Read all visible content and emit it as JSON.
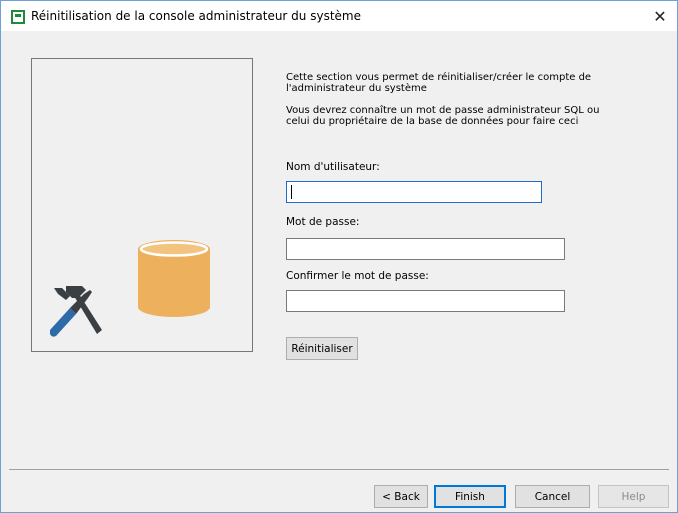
{
  "window": {
    "title": "Réinitilisation de la console administrateur du système",
    "close_glyph": "✕"
  },
  "illustration": {
    "icons": [
      "database-icon",
      "tools-icon"
    ],
    "colors": {
      "database": "#edb15e",
      "tools_handle": "#2c6aa8",
      "tools_metal": "#3a3f44"
    }
  },
  "content": {
    "description_1": "Cette section vous permet de réinitialiser/créer le compte de l'administrateur du système",
    "description_2": "Vous devrez connaître un mot de passe administrateur SQL ou celui du propriétaire de la base de données pour faire ceci",
    "username_label": "Nom d'utilisateur:",
    "username_value": "",
    "password_label": "Mot de passe:",
    "password_value": "",
    "confirm_label": "Confirmer le mot de passe:",
    "confirm_value": "",
    "reset_button": "Réinitialiser"
  },
  "footer": {
    "back_button": "< Back",
    "finish_button": "Finish",
    "cancel_button": "Cancel",
    "help_button": "Help"
  }
}
